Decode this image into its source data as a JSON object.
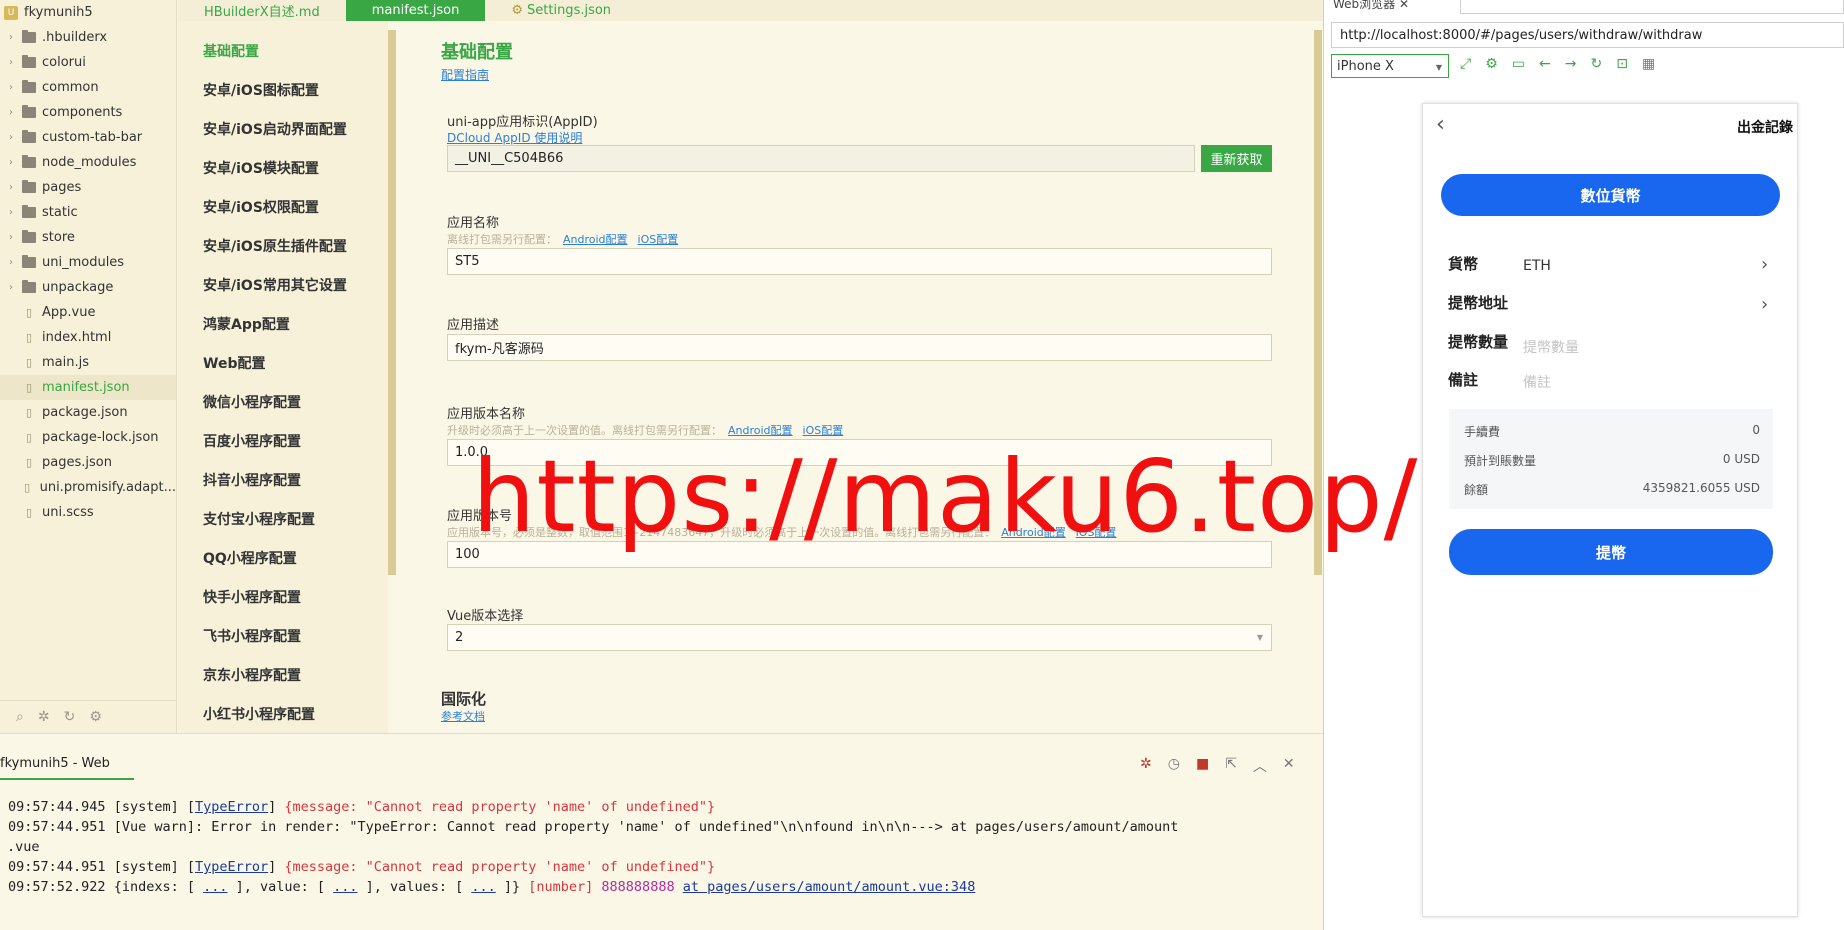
{
  "tree": {
    "root": "fkymunih5",
    "root_badge": "U",
    "items": [
      {
        "label": ".hbuilderx",
        "type": "folder"
      },
      {
        "label": "colorui",
        "type": "folder"
      },
      {
        "label": "common",
        "type": "folder"
      },
      {
        "label": "components",
        "type": "folder"
      },
      {
        "label": "custom-tab-bar",
        "type": "folder"
      },
      {
        "label": "node_modules",
        "type": "folder"
      },
      {
        "label": "pages",
        "type": "folder"
      },
      {
        "label": "static",
        "type": "folder"
      },
      {
        "label": "store",
        "type": "folder"
      },
      {
        "label": "uni_modules",
        "type": "folder"
      },
      {
        "label": "unpackage",
        "type": "folder"
      },
      {
        "label": "App.vue",
        "type": "file"
      },
      {
        "label": "index.html",
        "type": "file"
      },
      {
        "label": "main.js",
        "type": "file"
      },
      {
        "label": "manifest.json",
        "type": "file",
        "active": true
      },
      {
        "label": "package.json",
        "type": "file"
      },
      {
        "label": "package-lock.json",
        "type": "file"
      },
      {
        "label": "pages.json",
        "type": "file"
      },
      {
        "label": "uni.promisify.adapt...",
        "type": "file"
      },
      {
        "label": "uni.scss",
        "type": "file"
      }
    ]
  },
  "tabs": [
    {
      "label": "HBuilderX自述.md"
    },
    {
      "label": "manifest.json",
      "active": true
    },
    {
      "label": "Settings.json"
    }
  ],
  "confnav": [
    "基础配置",
    "安卓/iOS图标配置",
    "安卓/iOS启动界面配置",
    "安卓/iOS模块配置",
    "安卓/iOS权限配置",
    "安卓/iOS原生插件配置",
    "安卓/iOS常用其它设置",
    "鸿蒙App配置",
    "Web配置",
    "微信小程序配置",
    "百度小程序配置",
    "抖音小程序配置",
    "支付宝小程序配置",
    "QQ小程序配置",
    "快手小程序配置",
    "飞书小程序配置",
    "京东小程序配置",
    "小红书小程序配置"
  ],
  "form": {
    "title": "基础配置",
    "guide_link": "配置指南",
    "appid_label": "uni-app应用标识(AppID)",
    "appid_link": "DCloud AppID 使用说明",
    "appid_value": "__UNI__C504B66",
    "refetch_button": "重新获取",
    "name_label": "应用名称",
    "name_hint": "离线打包需另行配置：",
    "android_link": "Android配置",
    "ios_link": "iOS配置",
    "name_value": "ST5",
    "desc_label": "应用描述",
    "desc_value": "fkym-凡客源码",
    "vname_label": "应用版本名称",
    "vname_hint": "升级时必须高于上一次设置的值。离线打包需另行配置：",
    "vname_value": "1.0.0",
    "vcode_label": "应用版本号",
    "vcode_hint": "应用版本号，必须是整数，取值范围1~2147483647，升级时必须高于上一次设置的值。离线打包需另行配置：",
    "vcode_value": "100",
    "vue_label": "Vue版本选择",
    "vue_value": "2",
    "i18n_title": "国际化",
    "i18n_link": "参考文档"
  },
  "console": {
    "tab": "fkymunih5 - Web",
    "logs": [
      {
        "time": "09:57:44.945",
        "prefix": "[system] [",
        "type": "TypeError",
        "mid": "] ",
        "body": "{message: \"Cannot read property 'name' of undefined\"}"
      },
      {
        "time": "09:57:44.951",
        "text": "[Vue warn]: Error in render: \"TypeError: Cannot read property 'name' of undefined\"\\n\\nfound in\\n\\n---> at pages/users/amount/amount",
        "cont": ".vue"
      },
      {
        "time": "09:57:44.951",
        "prefix": "[system] [",
        "type": "TypeError",
        "mid": "] ",
        "body": "{message: \"Cannot read property 'name' of undefined\"}"
      },
      {
        "time": "09:57:52.922",
        "p1": "{indexs: [ ",
        "e1": "...",
        "p2": " ], value: [ ",
        "e2": "...",
        "p3": " ], values: [ ",
        "e3": "...",
        "p4": " ]} ",
        "num_type": "[number]",
        "num": "888888888",
        "loc": "at pages/users/amount/amount.vue:348"
      }
    ]
  },
  "browser": {
    "tab_title": "Web浏览器",
    "url": "http://localhost:8000/#/pages/users/withdraw/withdraw",
    "device": "iPhone X"
  },
  "phone": {
    "title": "出金記錄",
    "currency_button": "數位貨幣",
    "coin_label": "貨幣",
    "coin_value": "ETH",
    "address_label": "提幣地址",
    "amount_label": "提幣數量",
    "amount_placeholder": "提幣數量",
    "note_label": "備註",
    "note_placeholder": "備註",
    "fee_label": "手續費",
    "fee_value": "0",
    "expected_label": "預計到賬數量",
    "expected_value": "0 USD",
    "balance_label": "餘額",
    "balance_value": "4359821.6055 USD",
    "submit_button": "提幣"
  },
  "watermark": "https://maku6.top/",
  "colors": {
    "accent": "#3aa745",
    "phone_primary": "#1967ee",
    "watermark": "#f01010"
  }
}
